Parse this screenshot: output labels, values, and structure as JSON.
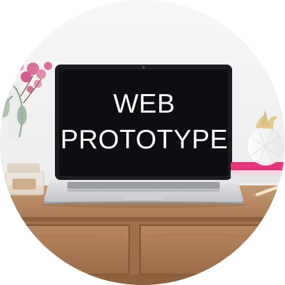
{
  "screen": {
    "line1": "WEB",
    "line2": "PROTOTYPE"
  },
  "colors": {
    "wall": "#f4f4f4",
    "desk": "#a97a55",
    "laptop_body": "#d9dadc",
    "screen": "#0d0d12",
    "notebook": "#e8367d",
    "flowers": "#d9709b"
  },
  "objects": [
    "flower-vase-icon",
    "stapler-icon",
    "laptop-icon",
    "pineapple-planter-icon",
    "pink-notebook-icon",
    "pencil-icon"
  ]
}
